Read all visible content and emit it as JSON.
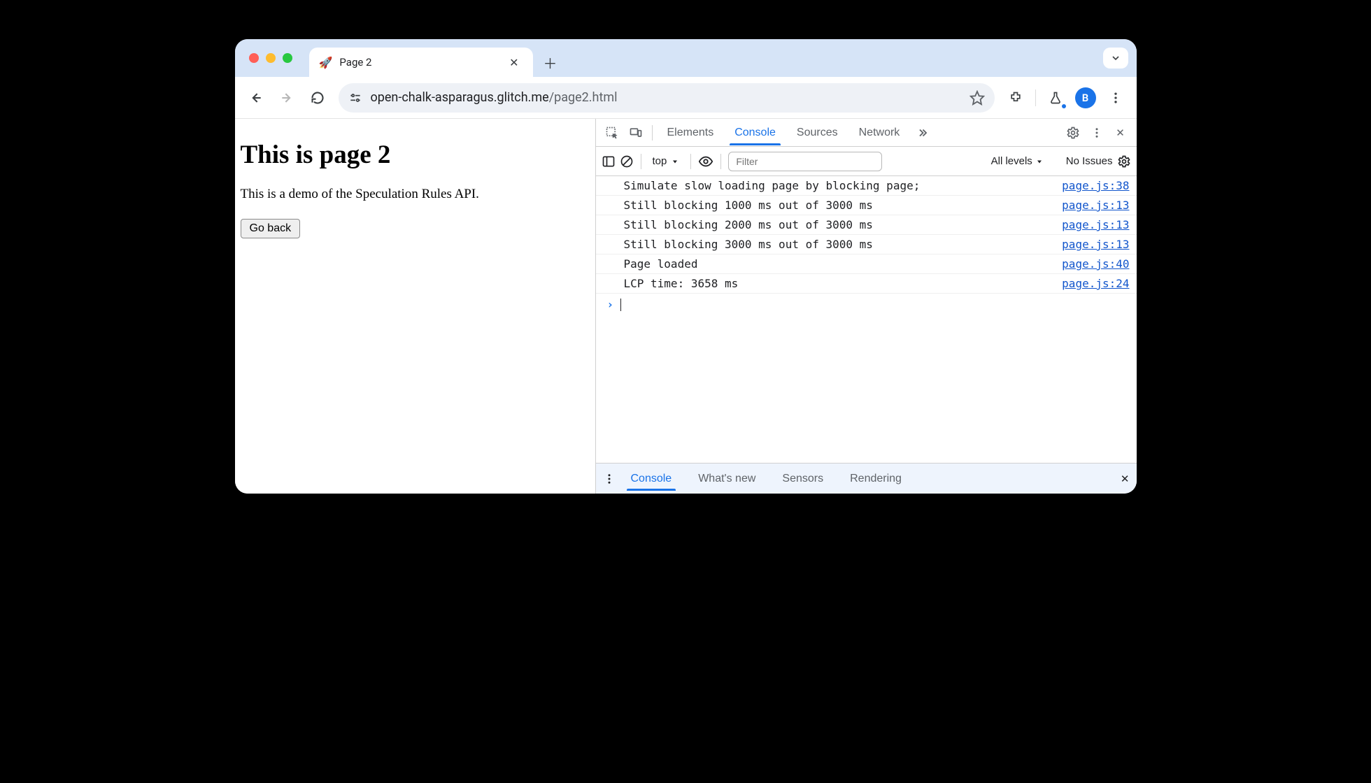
{
  "browser": {
    "tab": {
      "favicon": "🚀",
      "title": "Page 2"
    },
    "url_host": "open-chalk-asparagus.glitch.me",
    "url_path": "/page2.html",
    "avatar_letter": "B"
  },
  "page": {
    "heading": "This is page 2",
    "paragraph": "This is a demo of the Speculation Rules API.",
    "button_label": "Go back"
  },
  "devtools": {
    "tabs": [
      "Elements",
      "Console",
      "Sources",
      "Network"
    ],
    "active_tab": "Console",
    "context": "top",
    "filter_placeholder": "Filter",
    "levels_label": "All levels",
    "issues_label": "No Issues",
    "logs": [
      {
        "msg": "Simulate slow loading page by blocking page;",
        "src": "page.js:38"
      },
      {
        "msg": "Still blocking 1000 ms out of 3000 ms",
        "src": "page.js:13"
      },
      {
        "msg": "Still blocking 2000 ms out of 3000 ms",
        "src": "page.js:13"
      },
      {
        "msg": "Still blocking 3000 ms out of 3000 ms",
        "src": "page.js:13"
      },
      {
        "msg": "Page loaded",
        "src": "page.js:40"
      },
      {
        "msg": "LCP time: 3658 ms",
        "src": "page.js:24"
      }
    ],
    "drawer_tabs": [
      "Console",
      "What's new",
      "Sensors",
      "Rendering"
    ],
    "drawer_active": "Console"
  }
}
